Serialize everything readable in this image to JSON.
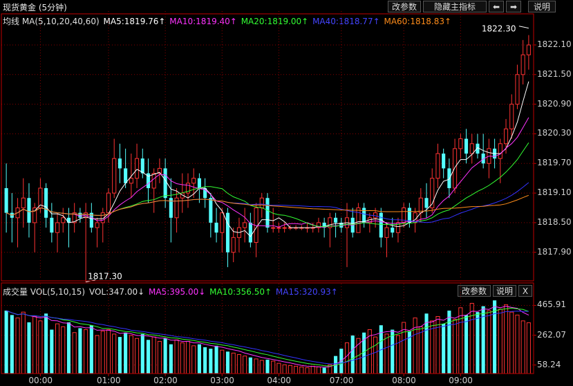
{
  "header": {
    "title": "现货黄金 (5分钟)",
    "buttons": {
      "params": "改参数",
      "hide": "隐藏主指标",
      "left": "⬅",
      "right": "➡",
      "help": "说明"
    }
  },
  "main_legend": {
    "prefix": "均线 MA(5,10,20,40,60)",
    "ma5": "MA5:1819.76↑",
    "ma10": "MA10:1819.40↑",
    "ma20": "MA20:1819.00↑",
    "ma40": "MA40:1818.77↑",
    "ma60": "MA60:1818.83↑"
  },
  "vol_legend": {
    "prefix": "成交量 VOL(5,10,15)",
    "vol": "VOL:347.00↓",
    "ma5": "MA5:395.00↓",
    "ma10": "MA10:356.50↑",
    "ma15": "MA15:320.93↑"
  },
  "vol_buttons": {
    "params": "改参数",
    "help": "说明",
    "close": "X"
  },
  "colors": {
    "up": "#ff3232",
    "down": "#54ffff",
    "ma5": "#ffffff",
    "ma10": "#ff33ff",
    "ma20": "#33ff33",
    "ma40": "#3333ff",
    "ma60": "#ff8c1a",
    "grid": "#8a0000",
    "axis": "#c00000"
  },
  "chart_data": [
    {
      "type": "candlestick",
      "title": "现货黄金 (5分钟)",
      "y_ticks": [
        1822.1,
        1821.5,
        1820.9,
        1820.3,
        1819.7,
        1819.1,
        1818.5,
        1817.9
      ],
      "ylim": [
        1817.3,
        1822.5
      ],
      "x_ticks": [
        "00:00",
        "01:00",
        "02:00",
        "03:00",
        "04:00",
        "07:00",
        "08:00",
        "09:00"
      ],
      "annotations": {
        "high": "1822.30",
        "low": "1817.30"
      },
      "candles": [
        [
          1819.2,
          1819.7,
          1818.3,
          1818.7
        ],
        [
          1818.7,
          1819.1,
          1818.1,
          1818.6
        ],
        [
          1818.6,
          1819.0,
          1818.0,
          1818.8
        ],
        [
          1818.8,
          1819.4,
          1818.4,
          1819.0
        ],
        [
          1819.0,
          1819.3,
          1818.2,
          1818.5
        ],
        [
          1818.5,
          1818.9,
          1817.9,
          1818.8
        ],
        [
          1818.8,
          1819.4,
          1818.7,
          1819.2
        ],
        [
          1819.2,
          1819.3,
          1818.4,
          1818.6
        ],
        [
          1818.6,
          1818.9,
          1818.1,
          1818.3
        ],
        [
          1818.3,
          1818.7,
          1817.9,
          1818.5
        ],
        [
          1818.5,
          1818.8,
          1818.3,
          1818.6
        ],
        [
          1818.6,
          1818.8,
          1818.0,
          1818.5
        ],
        [
          1818.5,
          1818.9,
          1818.3,
          1818.7
        ],
        [
          1818.7,
          1818.8,
          1818.5,
          1818.6
        ],
        [
          1818.6,
          1818.9,
          1817.3,
          1818.7
        ],
        [
          1818.7,
          1818.9,
          1818.3,
          1818.4
        ],
        [
          1818.4,
          1818.6,
          1818.0,
          1818.5
        ],
        [
          1818.5,
          1818.8,
          1818.1,
          1818.7
        ],
        [
          1818.7,
          1819.2,
          1818.5,
          1819.1
        ],
        [
          1819.1,
          1820.2,
          1819.0,
          1819.8
        ],
        [
          1819.8,
          1820.1,
          1819.3,
          1819.6
        ],
        [
          1819.6,
          1820.0,
          1819.2,
          1819.3
        ],
        [
          1819.3,
          1819.9,
          1819.0,
          1819.4
        ],
        [
          1819.4,
          1820.1,
          1819.2,
          1819.8
        ],
        [
          1819.8,
          1820.0,
          1819.4,
          1819.5
        ],
        [
          1819.5,
          1819.8,
          1818.9,
          1819.2
        ],
        [
          1819.2,
          1819.6,
          1818.7,
          1819.5
        ],
        [
          1819.5,
          1819.8,
          1819.3,
          1819.6
        ],
        [
          1819.6,
          1819.8,
          1818.8,
          1819.0
        ],
        [
          1819.0,
          1819.4,
          1818.1,
          1818.6
        ],
        [
          1818.6,
          1819.2,
          1818.3,
          1819.0
        ],
        [
          1819.0,
          1819.5,
          1818.7,
          1819.1
        ],
        [
          1819.1,
          1819.5,
          1818.8,
          1819.3
        ],
        [
          1819.3,
          1819.6,
          1819.0,
          1819.4
        ],
        [
          1819.4,
          1819.5,
          1818.9,
          1819.2
        ],
        [
          1819.2,
          1819.4,
          1818.8,
          1819.0
        ],
        [
          1819.0,
          1819.1,
          1818.2,
          1818.5
        ],
        [
          1818.5,
          1818.8,
          1818.1,
          1818.3
        ],
        [
          1818.3,
          1818.8,
          1817.9,
          1818.7
        ],
        [
          1818.7,
          1818.8,
          1817.6,
          1817.9
        ],
        [
          1817.9,
          1818.4,
          1817.7,
          1818.2
        ],
        [
          1818.2,
          1818.6,
          1817.9,
          1818.4
        ],
        [
          1818.4,
          1818.8,
          1818.1,
          1818.5
        ],
        [
          1818.5,
          1818.7,
          1818.0,
          1818.1
        ],
        [
          1818.1,
          1818.9,
          1817.8,
          1818.8
        ],
        [
          1818.8,
          1819.1,
          1818.6,
          1819.0
        ],
        [
          1819.0,
          1819.1,
          1818.3,
          1818.4
        ],
        [
          1818.4,
          1818.8,
          1818.3,
          1818.4
        ],
        [
          1818.4,
          1818.5,
          1818.3,
          1818.4
        ],
        [
          1818.4,
          1818.5,
          1818.3,
          1818.4
        ],
        [
          1818.4,
          1818.45,
          1818.35,
          1818.4
        ],
        [
          1818.4,
          1818.45,
          1818.35,
          1818.4
        ],
        [
          1818.4,
          1818.45,
          1818.35,
          1818.4
        ],
        [
          1818.4,
          1818.5,
          1818.3,
          1818.4
        ],
        [
          1818.4,
          1818.5,
          1818.3,
          1818.4
        ],
        [
          1818.4,
          1818.6,
          1818.3,
          1818.5
        ],
        [
          1818.5,
          1818.6,
          1818.2,
          1818.4
        ],
        [
          1818.4,
          1818.7,
          1818.0,
          1818.6
        ],
        [
          1818.6,
          1818.7,
          1818.2,
          1818.5
        ],
        [
          1818.5,
          1818.6,
          1818.3,
          1818.4
        ],
        [
          1818.4,
          1818.9,
          1817.6,
          1818.6
        ],
        [
          1818.6,
          1818.8,
          1818.2,
          1818.3
        ],
        [
          1818.3,
          1818.9,
          1818.3,
          1818.8
        ],
        [
          1818.8,
          1818.9,
          1818.4,
          1818.5
        ],
        [
          1818.5,
          1818.7,
          1818.3,
          1818.6
        ],
        [
          1818.6,
          1818.8,
          1818.4,
          1818.7
        ],
        [
          1818.7,
          1818.8,
          1818.0,
          1818.2
        ],
        [
          1818.2,
          1818.5,
          1817.8,
          1818.4
        ],
        [
          1818.4,
          1818.6,
          1818.2,
          1818.3
        ],
        [
          1818.3,
          1818.6,
          1818.1,
          1818.5
        ],
        [
          1818.5,
          1818.9,
          1818.4,
          1818.8
        ],
        [
          1818.8,
          1818.9,
          1818.4,
          1818.5
        ],
        [
          1818.5,
          1818.8,
          1818.3,
          1818.7
        ],
        [
          1818.7,
          1819.2,
          1818.5,
          1819.0
        ],
        [
          1819.0,
          1819.3,
          1818.6,
          1818.8
        ],
        [
          1818.8,
          1819.6,
          1818.7,
          1819.4
        ],
        [
          1819.4,
          1820.1,
          1819.2,
          1819.9
        ],
        [
          1819.9,
          1820.0,
          1819.4,
          1819.6
        ],
        [
          1819.6,
          1819.8,
          1819.0,
          1819.2
        ],
        [
          1819.2,
          1820.2,
          1819.1,
          1820.0
        ],
        [
          1820.0,
          1820.3,
          1819.8,
          1820.2
        ],
        [
          1820.2,
          1820.4,
          1819.7,
          1819.9
        ],
        [
          1819.9,
          1820.3,
          1819.7,
          1820.1
        ],
        [
          1820.1,
          1820.3,
          1819.8,
          1819.9
        ],
        [
          1819.9,
          1820.3,
          1819.6,
          1819.7
        ],
        [
          1819.7,
          1820.2,
          1819.4,
          1820.0
        ],
        [
          1820.0,
          1820.2,
          1819.6,
          1819.8
        ],
        [
          1819.8,
          1820.2,
          1819.3,
          1820.1
        ],
        [
          1820.1,
          1820.6,
          1819.9,
          1820.4
        ],
        [
          1820.4,
          1821.1,
          1820.2,
          1820.9
        ],
        [
          1820.9,
          1821.7,
          1820.8,
          1821.5
        ],
        [
          1821.5,
          1822.2,
          1821.3,
          1821.9
        ],
        [
          1821.9,
          1822.3,
          1821.6,
          1822.1
        ]
      ]
    },
    {
      "type": "bar",
      "title": "成交量 VOL(5,10,15)",
      "y_ticks": [
        465.91,
        262.07,
        58.24
      ],
      "ylim": [
        0,
        520
      ],
      "series_names": [
        "VOL",
        "MA5",
        "MA10",
        "MA15"
      ],
      "values": [
        430,
        400,
        380,
        420,
        350,
        390,
        360,
        410,
        300,
        340,
        320,
        350,
        280,
        310,
        300,
        330,
        260,
        290,
        300,
        270,
        250,
        280,
        260,
        240,
        270,
        230,
        250,
        220,
        240,
        200,
        230,
        210,
        220,
        190,
        200,
        180,
        170,
        190,
        160,
        150,
        140,
        130,
        120,
        110,
        100,
        90,
        95,
        85,
        70,
        60,
        55,
        50,
        45,
        40,
        50,
        45,
        40,
        60,
        120,
        170,
        210,
        260,
        240,
        280,
        300,
        250,
        330,
        270,
        300,
        260,
        350,
        290,
        380,
        320,
        410,
        360,
        390,
        340,
        430,
        370,
        450,
        400,
        480,
        420,
        460,
        430,
        500,
        440,
        470,
        420,
        400,
        360,
        347
      ]
    }
  ]
}
